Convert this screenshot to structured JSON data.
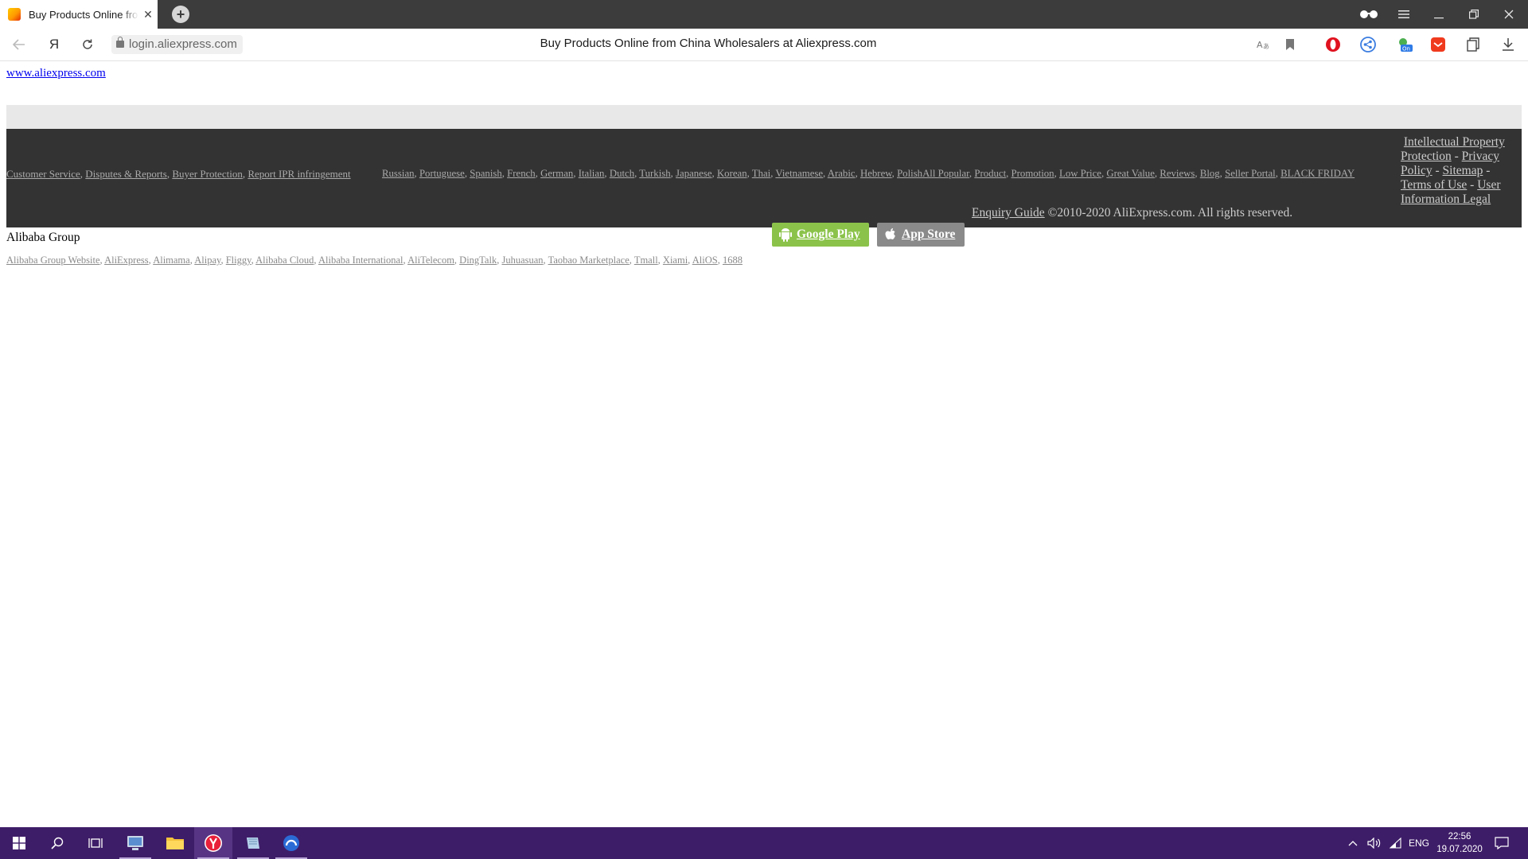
{
  "browser": {
    "tab_title": "Buy Products Online from China Wholesalers at Aliexpress.com",
    "tab_close": "✕",
    "new_tab": "+",
    "url": "login.aliexpress.com",
    "page_title": "Buy Products Online from China Wholesalers at Aliexpress.com",
    "yandex_btn": "Я"
  },
  "page": {
    "top_link": "www.aliexpress.com",
    "footer_left_links": [
      "Customer Service",
      "Disputes & Reports",
      "Buyer Protection",
      "Report IPR infringement"
    ],
    "footer_lang_links": [
      "Russian",
      "Portuguese",
      "Spanish",
      "French",
      "German",
      "Italian",
      "Dutch",
      "Turkish",
      "Japanese",
      "Korean",
      "Thai",
      "Vietnamese",
      "Arabic",
      "Hebrew",
      "PolishAll Popular",
      "Product",
      "Promotion",
      "Low Price",
      "Great Value",
      "Reviews",
      "Blog",
      "Seller Portal",
      "BLACK FRIDAY"
    ],
    "legal": {
      "ip": "Intellectual Property Protection",
      "privacy": "Privacy Policy",
      "sitemap": "Sitemap",
      "terms": "Terms of Use",
      "user_info": "User Information Legal",
      "sep": "-"
    },
    "enquiry": "Enquiry Guide",
    "copyright": "©2010-2020 AliExpress.com. All rights reserved.",
    "google_play": "Google Play",
    "app_store": "App Store",
    "group_title": "Alibaba Group",
    "group_links": [
      "Alibaba Group Website",
      "AliExpress",
      "Alimama",
      "Alipay",
      "Fliggy",
      "Alibaba Cloud",
      "Alibaba International",
      "AliTelecom",
      "DingTalk",
      "Juhuasuan",
      "Taobao Marketplace",
      "Tmall",
      "Xiami",
      "AliOS",
      "1688"
    ]
  },
  "taskbar": {
    "lang": "ENG",
    "time": "22:56",
    "date": "19.07.2020"
  },
  "colors": {
    "footer_bg": "#333333",
    "google_play_bg": "#8bc34a",
    "app_store_bg": "#8a8a8a",
    "taskbar_bg": "#3e1d68"
  },
  "icons": [
    "back-arrow-icon",
    "reload-icon",
    "lock-icon",
    "translate-icon",
    "bookmark-icon",
    "opera-icon",
    "share-icon",
    "weather-icon",
    "mail-icon",
    "collections-icon",
    "download-icon",
    "reader-glasses-icon",
    "menu-icon",
    "minimize-icon",
    "restore-icon",
    "close-icon",
    "android-icon",
    "apple-icon",
    "windows-start-icon",
    "search-icon",
    "task-view-icon",
    "chevron-up-icon",
    "speaker-icon",
    "network-icon",
    "notification-icon"
  ]
}
